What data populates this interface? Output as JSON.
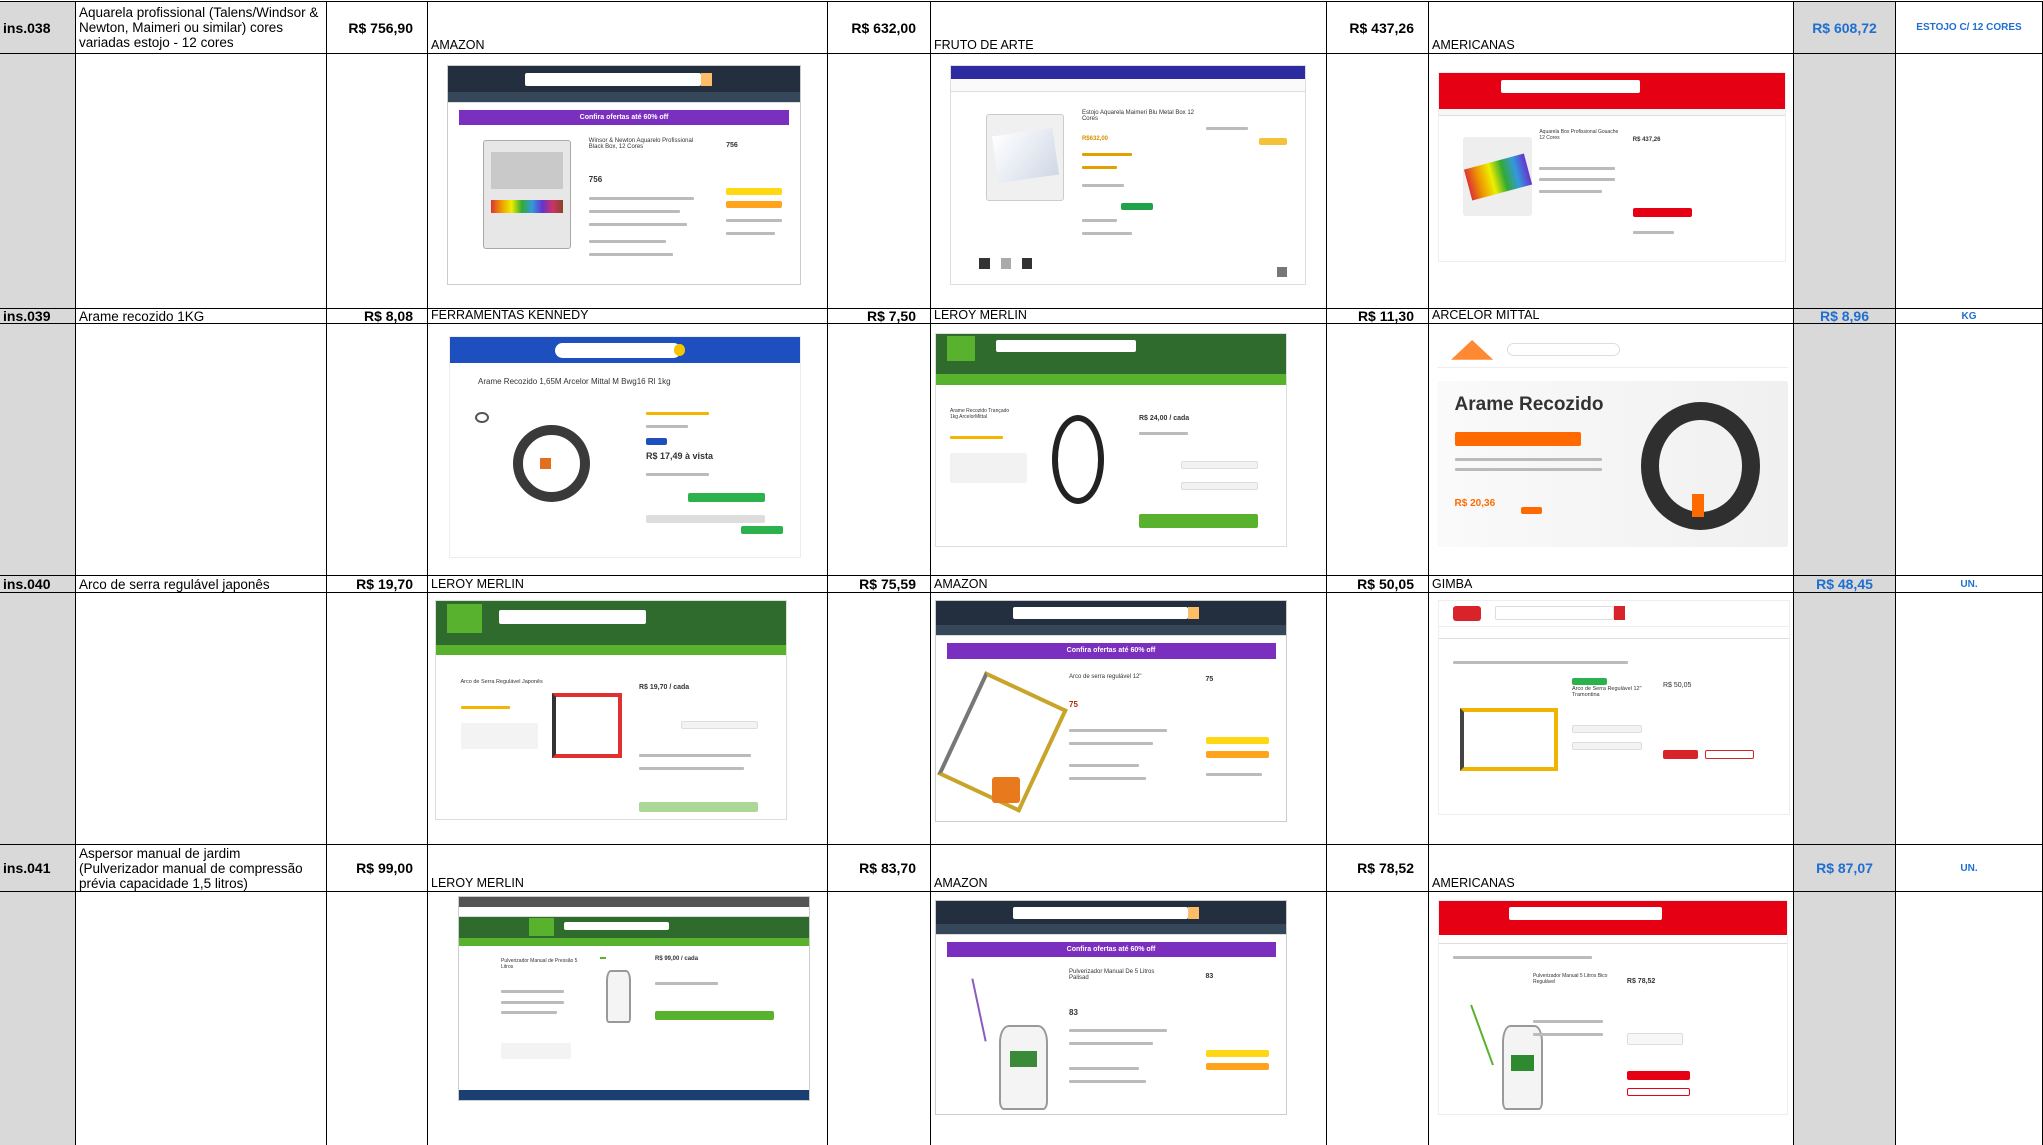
{
  "rows": [
    {
      "code": "ins.038",
      "description": "Aquarela profissional (Talens/Windsor & Newton, Maimeri ou similar)  cores variadas estojo - 12 cores",
      "quotes": [
        {
          "price": "R$ 756,90",
          "store": "AMAZON"
        },
        {
          "price": "R$ 632,00",
          "store": "FRUTO DE ARTE"
        },
        {
          "price": "R$ 437,26",
          "store": "AMERICANAS"
        }
      ],
      "average": "R$ 608,72",
      "unit": "ESTOJO C/ 12 CORES"
    },
    {
      "code": "ins.039",
      "description": "Arame recozido 1KG",
      "quotes": [
        {
          "price": "R$ 8,08",
          "store": "FERRAMENTAS KENNEDY"
        },
        {
          "price": "R$ 7,50",
          "store": "LEROY MERLIN"
        },
        {
          "price": "R$ 11,30",
          "store": "ARCELOR MITTAL"
        }
      ],
      "average": "R$ 8,96",
      "unit": "KG"
    },
    {
      "code": "ins.040",
      "description": "Arco de serra regulável japonês",
      "quotes": [
        {
          "price": "R$ 19,70",
          "store": "LEROY MERLIN"
        },
        {
          "price": "R$ 75,59",
          "store": "AMAZON"
        },
        {
          "price": "R$ 50,05",
          "store": "GIMBA"
        }
      ],
      "average": "R$ 48,45",
      "unit": "UN."
    },
    {
      "code": "ins.041",
      "description": "Aspersor manual de jardim (Pulverizador manual de compressão prévia capacidade 1,5 litros)",
      "quotes": [
        {
          "price": "R$ 99,00",
          "store": "LEROY MERLIN"
        },
        {
          "price": "R$ 83,70",
          "store": "AMAZON"
        },
        {
          "price": "R$ 78,52",
          "store": "AMERICANAS"
        }
      ],
      "average": "R$ 87,07",
      "unit": "UN."
    }
  ],
  "screenshots": {
    "r38": [
      {
        "title": "Winsor & Newton Aquarelo Profissional Black Box, 12 Cores",
        "price": "756",
        "banner": "Confira ofertas até 60% off"
      },
      {
        "title": "Estojo Aquarela Maimeri Blu Metal Box 12 Cores",
        "price": "R$632,00"
      },
      {
        "title": "Aquarela Box Profissional Gouache 12 Cores",
        "price": "R$ 437,26"
      }
    ],
    "r39": [
      {
        "title": "Arame Recozido 1,65M Arcelor Mittal M Bwg16 Rl 1kg",
        "price": "R$ 17,49 à vista"
      },
      {
        "title": "Arame Recozido Trançado 1kg ArcelorMittal",
        "price": "R$ 24,00 / cada"
      },
      {
        "title": "Arame Recozido",
        "price": "R$ 20,36"
      }
    ],
    "r40": [
      {
        "title": "Arco de Serra Regulável Japonês",
        "price": "R$ 19,70 / cada"
      },
      {
        "title": "Arco de serra regulável 12\"",
        "price": "75",
        "banner": "Confira ofertas até 60% off"
      },
      {
        "title": "Arco de Serra Regulável 12\" Tramontina",
        "price": "R$ 50,05"
      }
    ],
    "r41": [
      {
        "title": "Pulverizador Manual de Pressão 5 Litros",
        "price": "R$ 99,00 / cada"
      },
      {
        "title": "Pulverizador Manual De 5 Litros Palisad",
        "price": "83",
        "banner": "Confira ofertas até 60% off"
      },
      {
        "title": "Pulverizador Manual 5 Litros Bico Regulável",
        "price": "R$ 78,52"
      }
    ]
  },
  "colors": {
    "grid_gray": "#d9d9d9",
    "average_blue": "#1f6fd1",
    "amazon_dark": "#232f3e",
    "leroy_green": "#58b22d",
    "americanas_red": "#e60014",
    "kennedy_blue": "#1d4fbf",
    "gimba_red": "#d8232a"
  }
}
